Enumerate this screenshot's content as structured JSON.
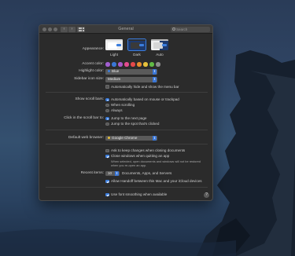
{
  "window": {
    "title": "General"
  },
  "search": {
    "placeholder": "Search"
  },
  "appearance": {
    "label": "Appearance:",
    "options": [
      {
        "name": "Light",
        "bar": "#dcdcdc",
        "bg": "#eeeeee",
        "win": "#ffffff"
      },
      {
        "name": "Dark",
        "bar": "#2f2f2f",
        "bg": "#1e3a6e",
        "win": "#3a3a3a"
      },
      {
        "name": "Auto",
        "bar": "#bcbcbc",
        "bg": "#4c6a98",
        "win": "#d6d6d6"
      }
    ],
    "selected": "Dark"
  },
  "accent": {
    "label": "Accent color:",
    "colors": [
      "#a25fd1",
      "#3a76d6",
      "#a759c9",
      "#e24b8e",
      "#e5494a",
      "#e88c2e",
      "#e6c13b",
      "#61bb46",
      "#8c8c8c"
    ]
  },
  "highlight": {
    "label": "Highlight color:",
    "value": "Blue"
  },
  "sidebar_icon": {
    "label": "Sidebar icon size:",
    "value": "Medium"
  },
  "menubar": {
    "label": "Automatically hide and show the menu bar"
  },
  "scrollbars": {
    "label": "Show scroll bars:",
    "options": [
      "Automatically based on mouse or trackpad",
      "When scrolling",
      "Always"
    ]
  },
  "scroll_click": {
    "label": "Click in the scroll bar to:",
    "options": [
      "Jump to the next page",
      "Jump to the spot that's clicked"
    ]
  },
  "browser": {
    "label": "Default web browser:",
    "value": "Google Chrome"
  },
  "documents": {
    "ask_label": "Ask to keep changes when closing documents",
    "close_label": "Close windows when quitting an app",
    "close_note": "When selected, open documents and windows will not be restored when you re-open an app."
  },
  "recent": {
    "label": "Recent items:",
    "value": "10",
    "suffix": "Documents, Apps, and Servers"
  },
  "handoff": {
    "label": "Allow Handoff between this Mac and your iCloud devices"
  },
  "font_smoothing": {
    "label": "Use font smoothing when available"
  },
  "help": {
    "symbol": "?"
  }
}
